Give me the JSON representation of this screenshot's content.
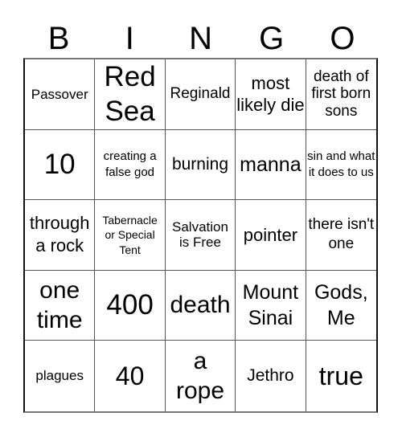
{
  "header": [
    "B",
    "I",
    "N",
    "G",
    "O"
  ],
  "cells": [
    "Passover",
    "Red Sea",
    "Reginald",
    "most likely die",
    "death of first born sons",
    "10",
    "creating a false god",
    "burning",
    "manna",
    "sin and what it does to us",
    "through a rock",
    "Tabernacle or Special Tent",
    "Salvation is Free",
    "pointer",
    "there isn't one",
    "one time",
    "400",
    "death",
    "Mount Sinai",
    "Gods, Me",
    "plagues",
    "40",
    "a rope",
    "Jethro",
    "true"
  ]
}
